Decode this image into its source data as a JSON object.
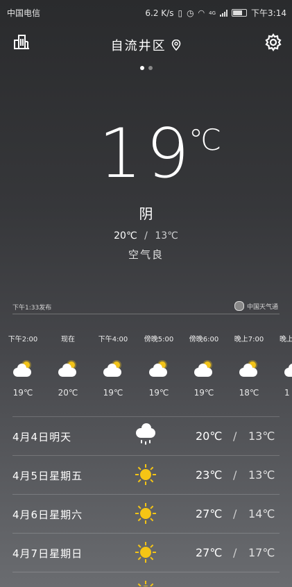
{
  "status_bar": {
    "carrier": "中国电信",
    "speed": "6.2 K/s",
    "network": "4G",
    "time": "下午3:14"
  },
  "header": {
    "city": "自流井区",
    "icons": [
      "city-buildings-icon",
      "location-pin-icon",
      "gear-icon"
    ]
  },
  "pager": {
    "count": 2,
    "active": 0
  },
  "current": {
    "temp": "19",
    "unit": "℃",
    "condition": "阴",
    "high": "20℃",
    "separator": "/",
    "low": "13℃",
    "air_quality": "空气良"
  },
  "publish": {
    "time": "下午1:33发布",
    "source": "中国天气通"
  },
  "hourly": [
    {
      "time": "下午2:00",
      "temp": "19℃",
      "icon": "partly-cloudy-icon"
    },
    {
      "time": "现在",
      "temp": "20℃",
      "icon": "partly-cloudy-icon"
    },
    {
      "time": "下午4:00",
      "temp": "19℃",
      "icon": "partly-cloudy-icon"
    },
    {
      "time": "傍晚5:00",
      "temp": "19℃",
      "icon": "partly-cloudy-icon"
    },
    {
      "time": "傍晚6:00",
      "temp": "19℃",
      "icon": "partly-cloudy-icon"
    },
    {
      "time": "晚上7:00",
      "temp": "18℃",
      "icon": "partly-cloudy-icon"
    },
    {
      "time": "晚上",
      "temp": "1",
      "icon": "partly-cloudy-icon"
    }
  ],
  "daily": [
    {
      "date": "4月4日明天",
      "icon": "rain-cloud-icon",
      "high": "20℃",
      "low": "13℃"
    },
    {
      "date": "4月5日星期五",
      "icon": "sun-icon",
      "high": "23℃",
      "low": "13℃"
    },
    {
      "date": "4月6日星期六",
      "icon": "sun-icon",
      "high": "27℃",
      "low": "14℃"
    },
    {
      "date": "4月7日星期日",
      "icon": "sun-icon",
      "high": "27℃",
      "low": "17℃"
    }
  ],
  "colors": {
    "sun": "#f5c515",
    "background_top": "#2a2b2d",
    "background_bottom": "#6a6c70"
  }
}
